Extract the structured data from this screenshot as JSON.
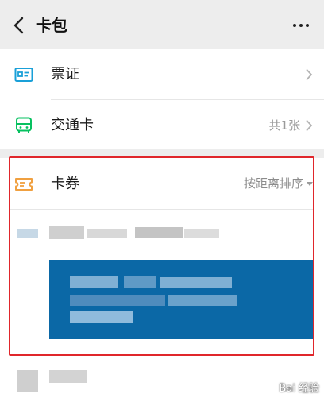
{
  "header": {
    "title": "卡包",
    "back_icon": "chevron-left-icon",
    "more_icon": "more-dots-icon"
  },
  "list": {
    "items": [
      {
        "label": "票证",
        "icon": "ticket-id-icon",
        "right_text": ""
      },
      {
        "label": "交通卡",
        "icon": "bus-icon",
        "right_text": "共1张"
      }
    ]
  },
  "coupons": {
    "label": "卡券",
    "icon": "coupon-icon",
    "sort_label": "按距离排序"
  },
  "colors": {
    "accent_blue": "#1aa0d8",
    "accent_green": "#07c160",
    "accent_orange": "#f0a040",
    "highlight_red": "#e0262b",
    "card_blue": "#0b68a6"
  },
  "watermark": "Bai 经验"
}
